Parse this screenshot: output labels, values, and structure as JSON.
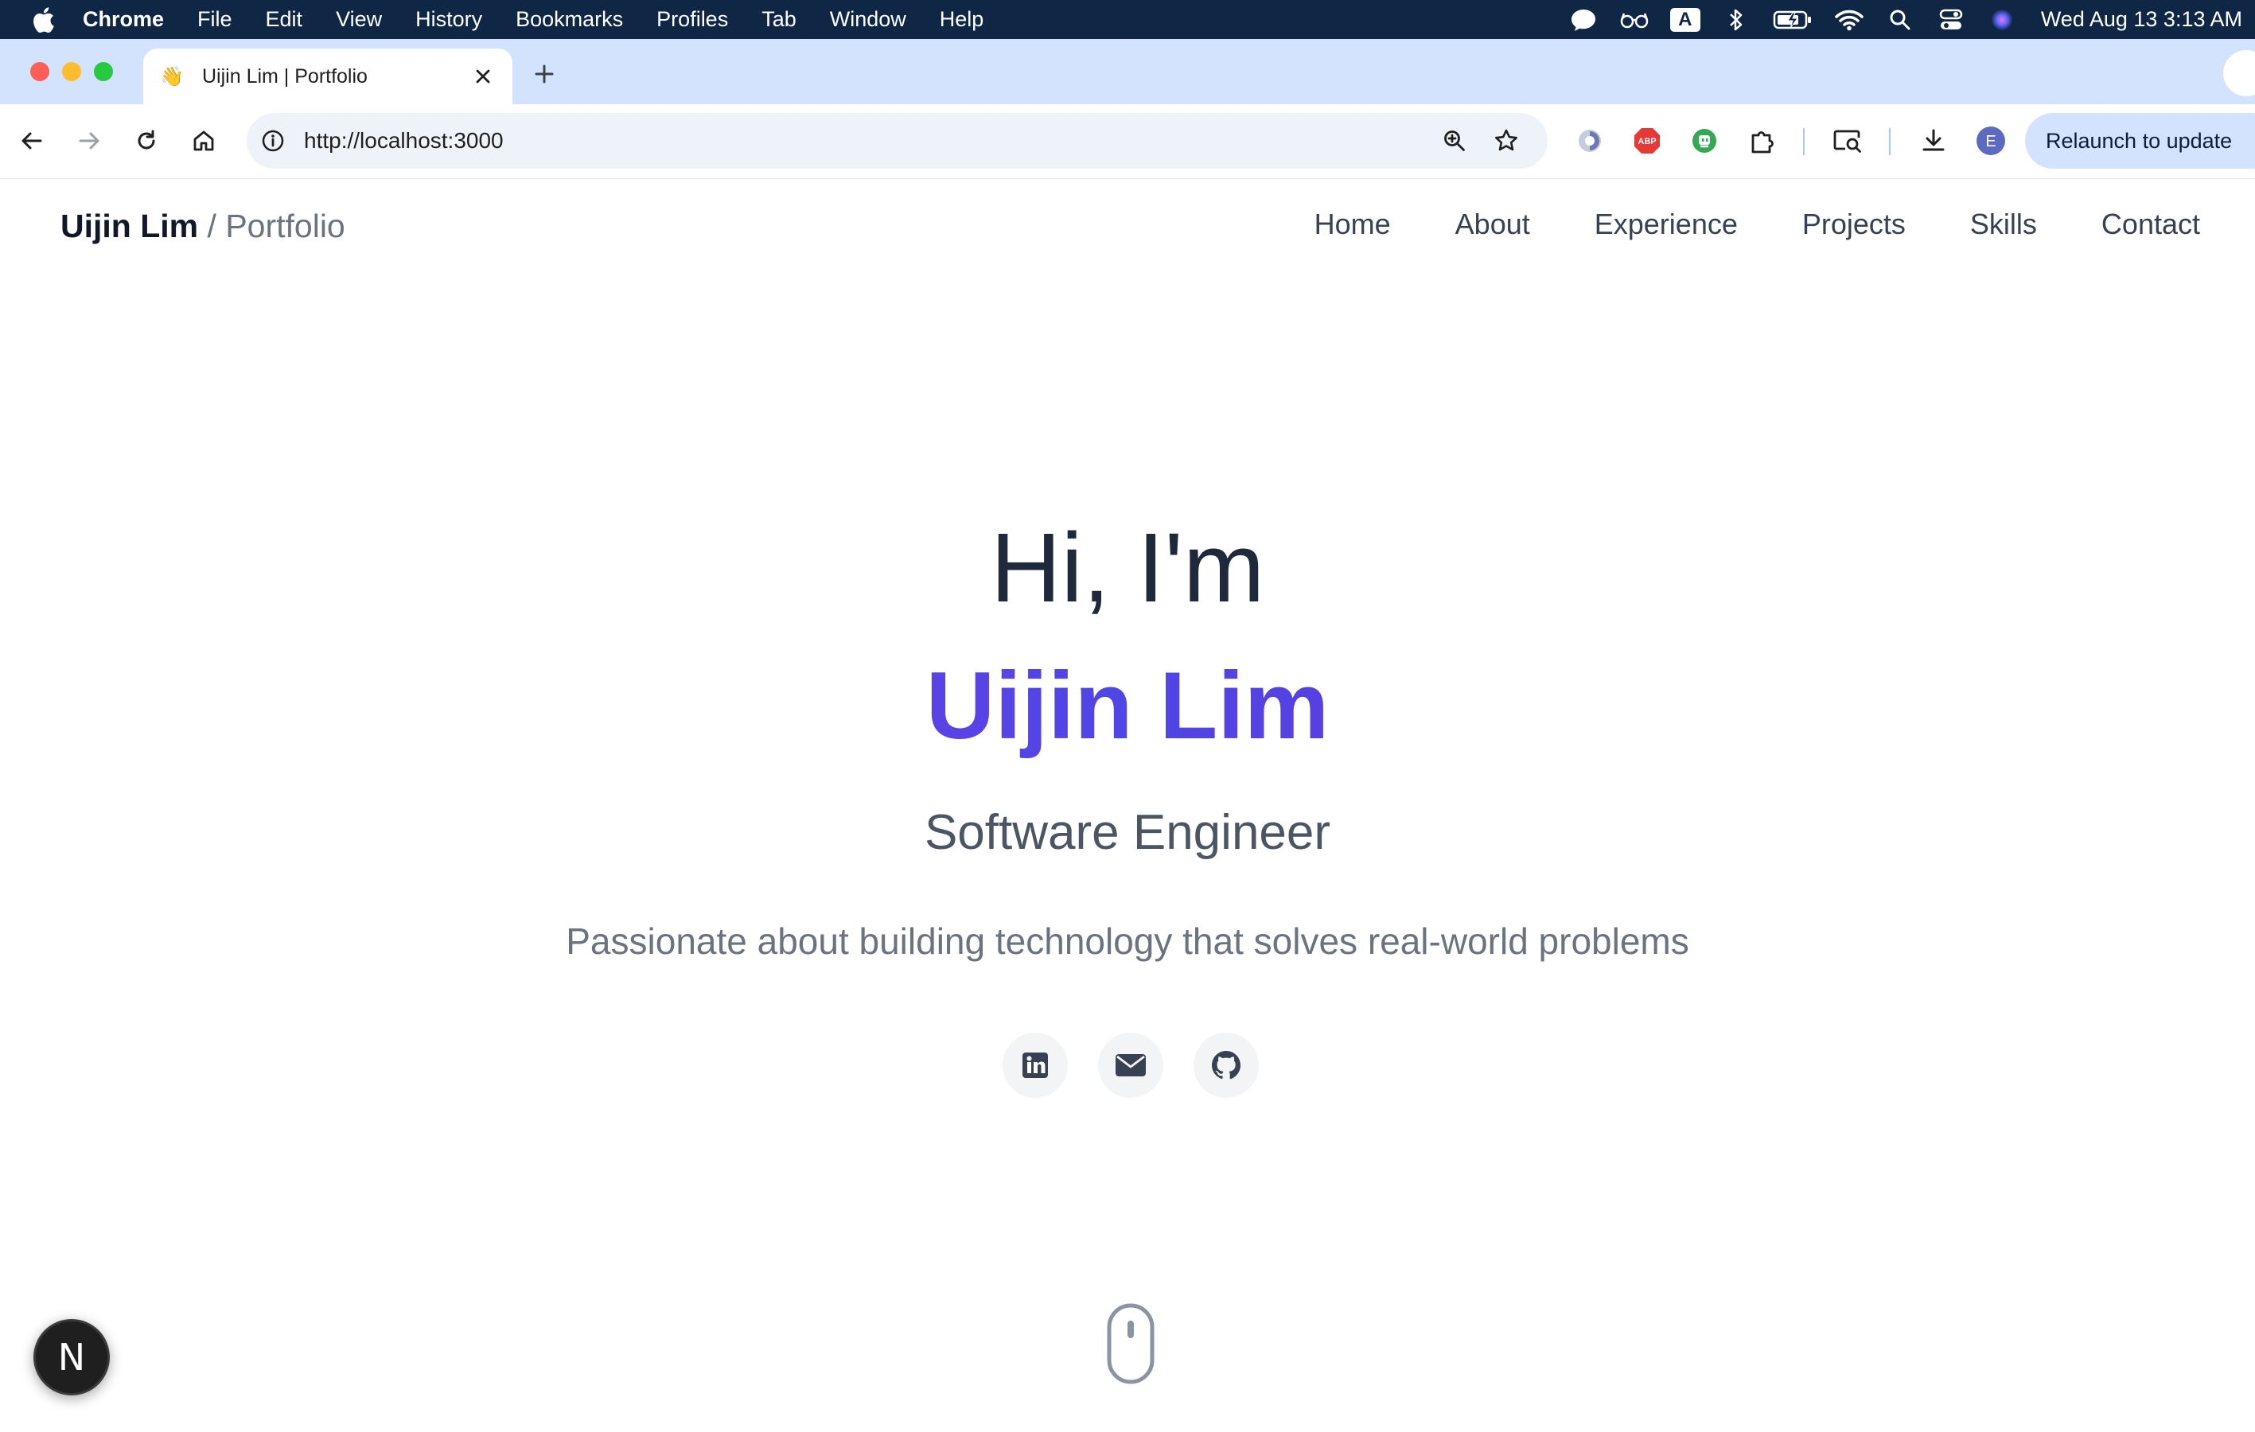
{
  "menubar": {
    "app_name": "Chrome",
    "menus": [
      "File",
      "Edit",
      "View",
      "History",
      "Bookmarks",
      "Profiles",
      "Tab",
      "Window",
      "Help"
    ],
    "a_indicator": "A",
    "clock": "Wed Aug 13  3:13 AM"
  },
  "tab": {
    "favicon": "👋",
    "title": "Uijin Lim | Portfolio"
  },
  "toolbar": {
    "url": "http://localhost:3000",
    "abp_label": "ABP",
    "profile_initial": "E",
    "relaunch_label": "Relaunch to update"
  },
  "site": {
    "brand_name": "Uijin Lim",
    "brand_separator": "/",
    "brand_sub": "Portfolio",
    "nav": [
      "Home",
      "About",
      "Experience",
      "Projects",
      "Skills",
      "Contact"
    ],
    "greeting": "Hi, I'm",
    "name": "Uijin Lim",
    "role": "Software Engineer",
    "tagline": "Passionate about building technology that solves real-world problems",
    "social_icons": [
      "linkedin-icon",
      "email-icon",
      "github-icon"
    ]
  },
  "dev_badge": "N",
  "colors": {
    "menubar_bg": "#0f2744",
    "tabstrip_bg": "#d3e3fd",
    "gradient_start": "#9333ea",
    "gradient_mid": "#4f46e5",
    "gradient_end": "#7e22ce",
    "heading": "#1e293b",
    "muted": "#6b7280"
  }
}
